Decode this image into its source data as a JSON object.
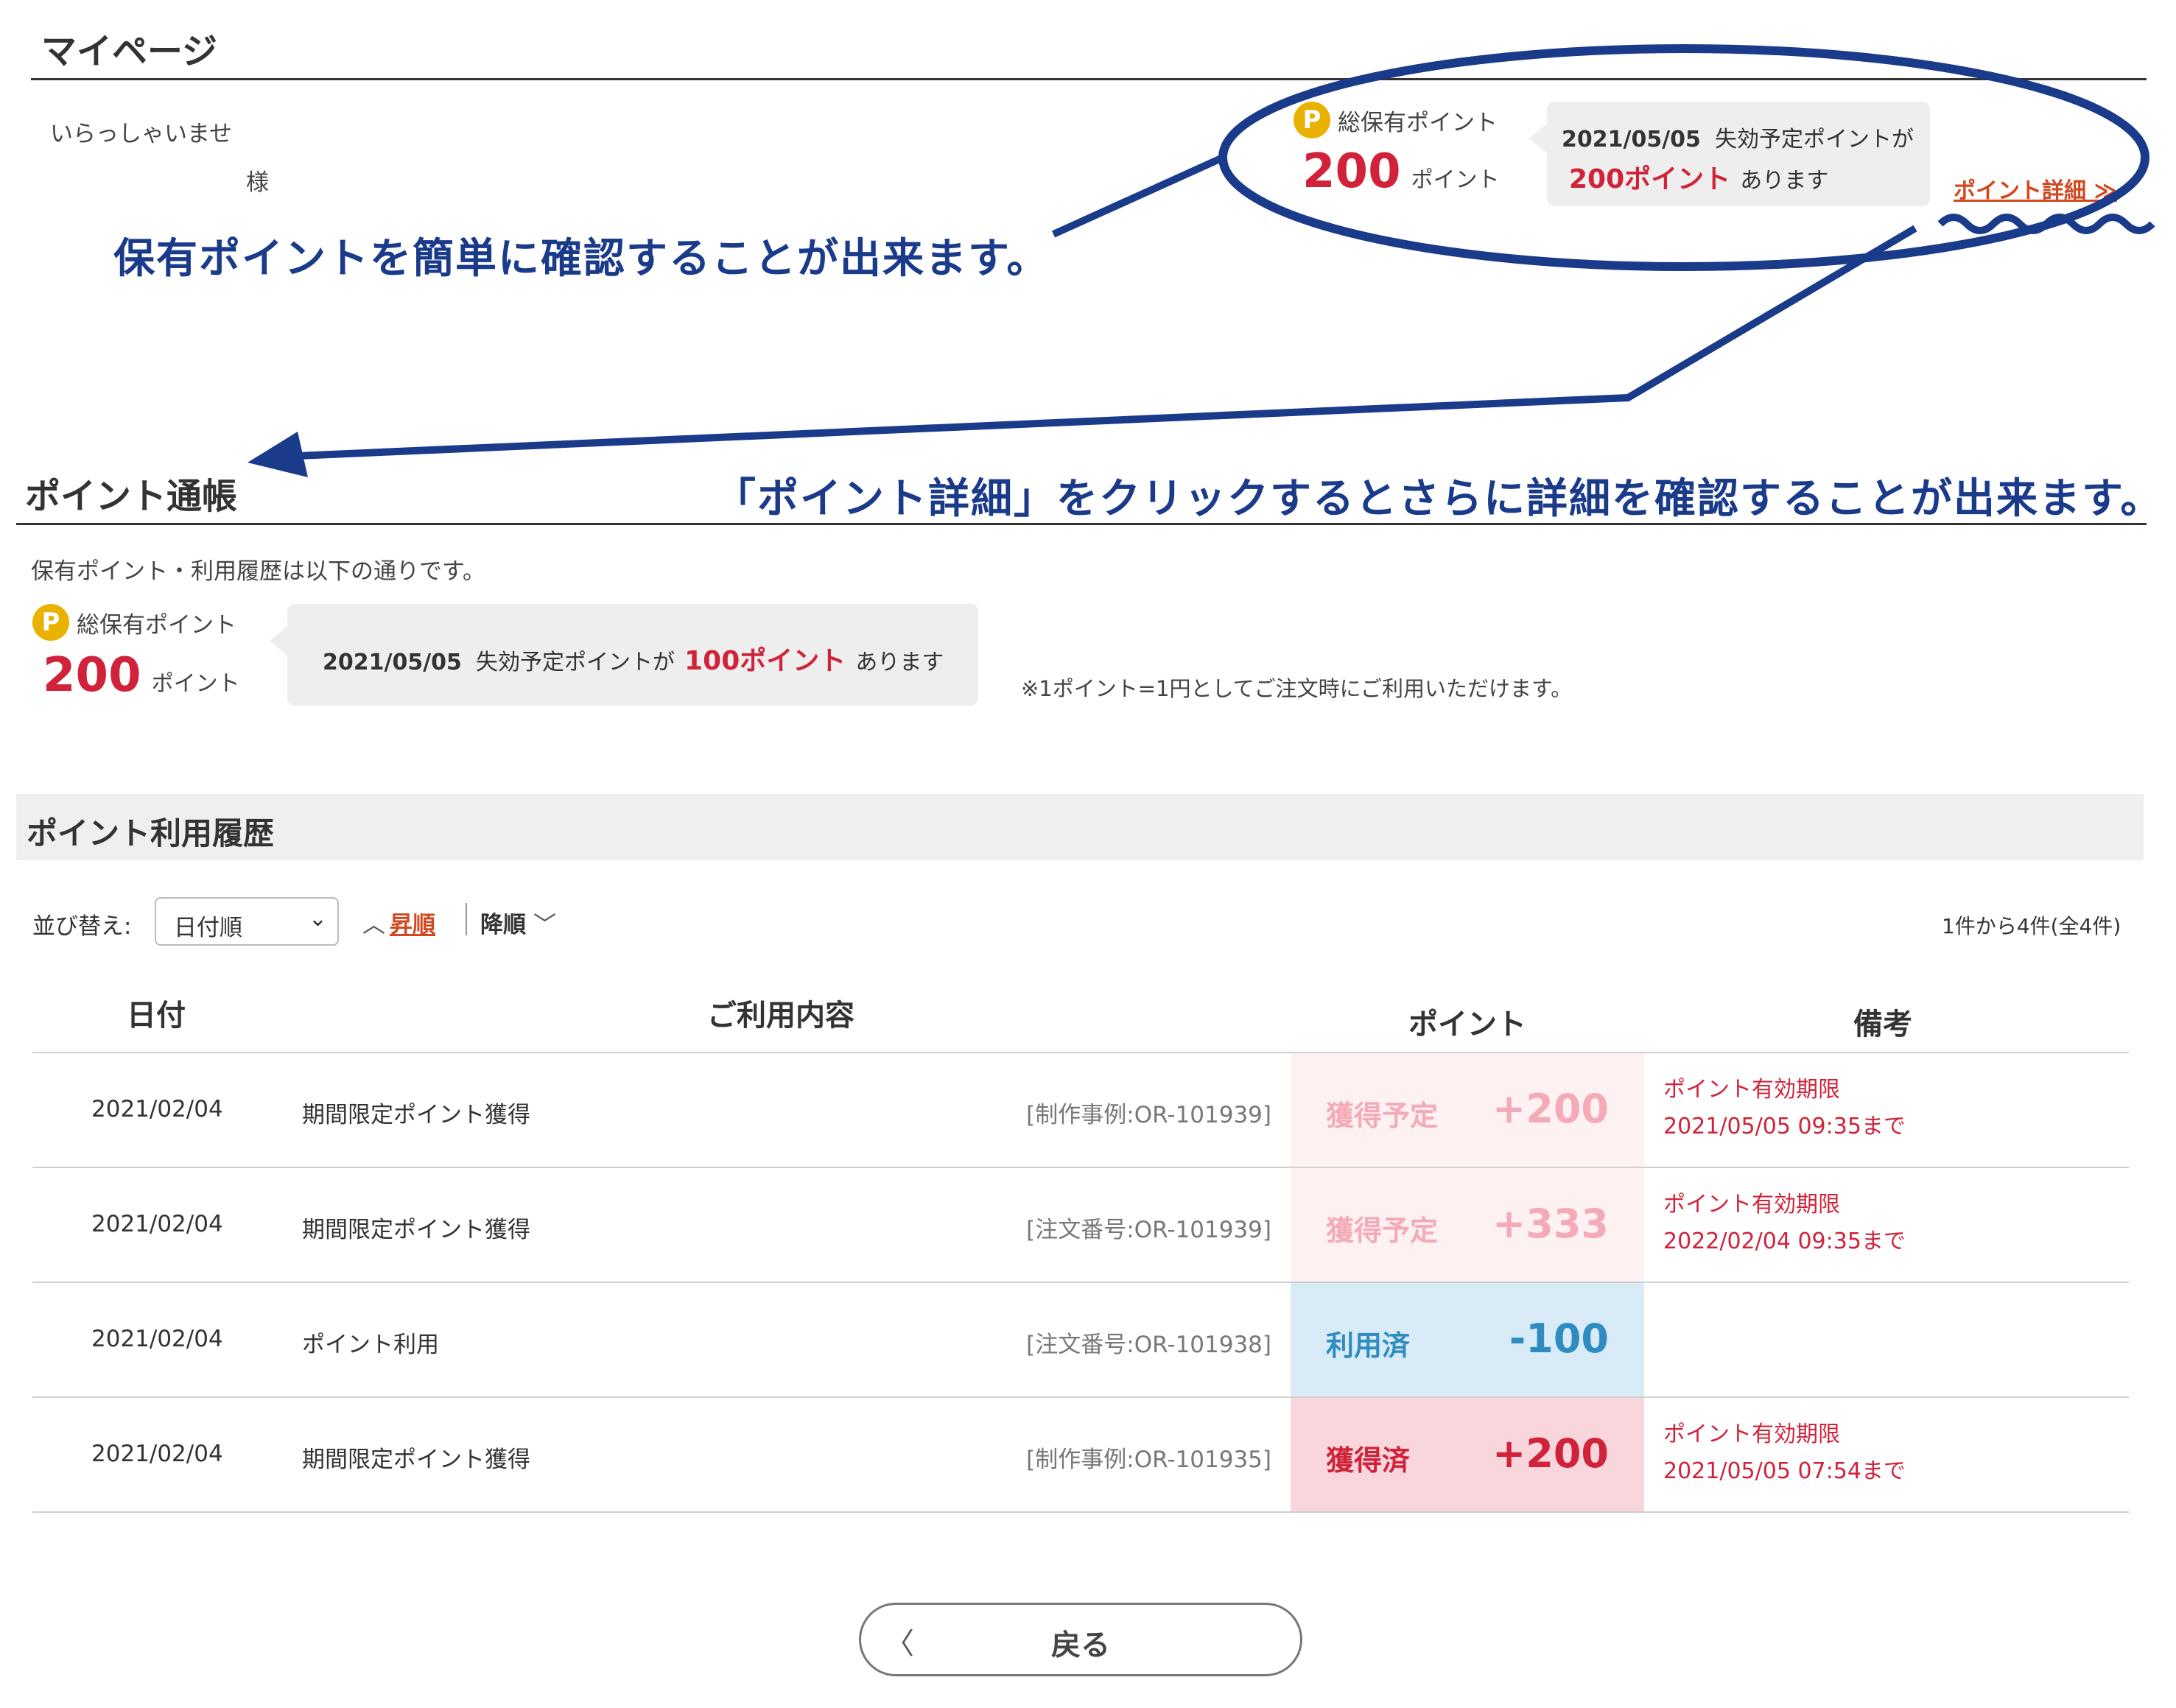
{
  "mypage": {
    "title": "マイページ",
    "welcome": "いらっしゃいませ",
    "honorific": "様",
    "total_points_label": "総保有ポイント",
    "total_points_value": "200",
    "points_unit": "ポイント",
    "expiry_date": "2021/05/05",
    "expiry_text": "失効予定ポイントが",
    "expiry_points": "200ポイント",
    "expiry_suffix": "あります",
    "detail_link": "ポイント詳細 ≫"
  },
  "annotations": {
    "note1": "保有ポイントを簡単に確認することが出来ます。",
    "note2": "「ポイント詳細」をクリックするとさらに詳細を確認することが出来ます。",
    "color": "#1a3a8a"
  },
  "passbook": {
    "title": "ポイント通帳",
    "intro": "保有ポイント・利用履歴は以下の通りです。",
    "total_points_label": "総保有ポイント",
    "total_points_value": "200",
    "points_unit": "ポイント",
    "expiry_date": "2021/05/05",
    "expiry_text": "失効予定ポイントが",
    "expiry_points": "100ポイント",
    "expiry_suffix": "あります",
    "note": "※1ポイント=1円としてご注文時にご利用いただけます。"
  },
  "history": {
    "title": "ポイント利用履歴",
    "sort_label": "並び替え:",
    "sort_selected": "日付順",
    "asc_label": "昇順",
    "desc_label": "降順",
    "count": "1件から4件(全4件)",
    "columns": [
      "日付",
      "ご利用内容",
      "ポイント",
      "備考"
    ],
    "rows": [
      {
        "date": "2021/02/04",
        "desc": "期間限定ポイント獲得",
        "ref": "[制作事例:OR-101939]",
        "status": "獲得予定",
        "amount": "+200",
        "note1": "ポイント有効期限",
        "note2": "2021/05/05 09:35まで"
      },
      {
        "date": "2021/02/04",
        "desc": "期間限定ポイント獲得",
        "ref": "[注文番号:OR-101939]",
        "status": "獲得予定",
        "amount": "+333",
        "note1": "ポイント有効期限",
        "note2": "2022/02/04 09:35まで"
      },
      {
        "date": "2021/02/04",
        "desc": "ポイント利用",
        "ref": "[注文番号:OR-101938]",
        "status": "利用済",
        "amount": "-100",
        "note1": "",
        "note2": ""
      },
      {
        "date": "2021/02/04",
        "desc": "期間限定ポイント獲得",
        "ref": "[制作事例:OR-101935]",
        "status": "獲得済",
        "amount": "+200",
        "note1": "ポイント有効期限",
        "note2": "2021/05/05 07:54まで"
      }
    ]
  },
  "back_button": "戻る",
  "colors": {
    "accent_red": "#d0233a",
    "link_orange": "#d1481f",
    "badge_gold": "#e9b200",
    "used_blue": "#2f8cc0"
  }
}
